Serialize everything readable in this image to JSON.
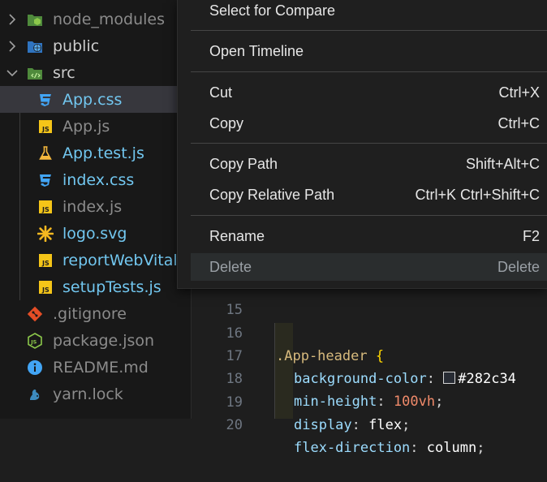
{
  "explorer": {
    "items": [
      {
        "label": "node_modules",
        "icon": "folder-node-icon",
        "twist": "chevron-right"
      },
      {
        "label": "public",
        "icon": "folder-public-icon",
        "twist": "chevron-right"
      },
      {
        "label": "src",
        "icon": "folder-src-icon",
        "twist": "chevron-down"
      },
      {
        "label": "App.css",
        "icon": "css-file-icon"
      },
      {
        "label": "App.js",
        "icon": "js-file-icon"
      },
      {
        "label": "App.test.js",
        "icon": "test-file-icon"
      },
      {
        "label": "index.css",
        "icon": "css-file-icon"
      },
      {
        "label": "index.js",
        "icon": "js-file-icon"
      },
      {
        "label": "logo.svg",
        "icon": "svg-file-icon"
      },
      {
        "label": "reportWebVitals",
        "icon": "js-file-icon"
      },
      {
        "label": "setupTests.js",
        "icon": "js-file-icon"
      },
      {
        "label": ".gitignore",
        "icon": "git-file-icon"
      },
      {
        "label": "package.json",
        "icon": "nodejs-file-icon"
      },
      {
        "label": "README.md",
        "icon": "info-file-icon"
      },
      {
        "label": "yarn.lock",
        "icon": "yarn-file-icon"
      }
    ]
  },
  "context_menu": {
    "select_for_compare": "Select for Compare",
    "open_timeline": "Open Timeline",
    "cut": {
      "label": "Cut",
      "shortcut": "Ctrl+X"
    },
    "copy": {
      "label": "Copy",
      "shortcut": "Ctrl+C"
    },
    "copy_path": {
      "label": "Copy Path",
      "shortcut": "Shift+Alt+C"
    },
    "copy_relative_path": {
      "label": "Copy Relative Path",
      "shortcut": "Ctrl+K Ctrl+Shift+C"
    },
    "rename": {
      "label": "Rename",
      "shortcut": "F2"
    },
    "delete": {
      "label": "Delete",
      "shortcut": "Delete"
    }
  },
  "editor": {
    "line_numbers": [
      "15",
      "16",
      "17",
      "18",
      "19",
      "20"
    ],
    "selector": ".App-header",
    "open_brace": "{",
    "props": [
      {
        "name": "background-color",
        "value": "#282c34"
      },
      {
        "name": "min-height",
        "value_num": "100",
        "value_unit": "vh"
      },
      {
        "name": "display",
        "value": "flex"
      },
      {
        "name": "flex-direction",
        "value": "column"
      }
    ],
    "colon": ":",
    "semicolon": ";"
  }
}
